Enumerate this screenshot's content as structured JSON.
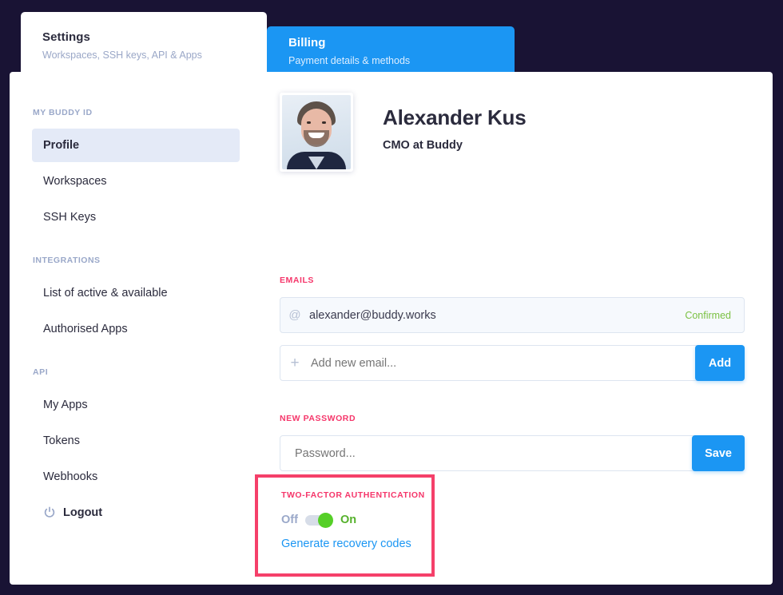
{
  "theme": {
    "background": "#191334",
    "panel": "#ffffff",
    "accent_blue": "#1b96f3",
    "accent_pink": "#f5366a",
    "accent_green": "#55cf27",
    "active_nav": "#e4eaf7",
    "muted_text": "#9aa8c9",
    "annotation_red": "#f5406a"
  },
  "tabs": [
    {
      "id": "settings",
      "title": "Settings",
      "subtitle": "Workspaces, SSH keys, API & Apps",
      "active": true
    },
    {
      "id": "billing",
      "title": "Billing",
      "subtitle": "Payment details & methods",
      "active": false
    }
  ],
  "sidebar": {
    "groups": [
      {
        "label": "MY BUDDY ID",
        "items": [
          {
            "label": "Profile",
            "active": true
          },
          {
            "label": "Workspaces",
            "active": false
          },
          {
            "label": "SSH Keys",
            "active": false
          }
        ]
      },
      {
        "label": "INTEGRATIONS",
        "items": [
          {
            "label": "List of active & available",
            "active": false
          },
          {
            "label": "Authorised Apps",
            "active": false
          }
        ]
      },
      {
        "label": "API",
        "items": [
          {
            "label": "My Apps",
            "active": false
          },
          {
            "label": "Tokens",
            "active": false
          },
          {
            "label": "Webhooks",
            "active": false
          }
        ]
      }
    ],
    "logout": {
      "label": "Logout",
      "icon": "power-icon"
    }
  },
  "profile": {
    "name": "Alexander Kus",
    "role": "CMO at Buddy",
    "avatar_alt": "Alexander Kus profile photo"
  },
  "emails": {
    "label": "EMAILS",
    "existing": {
      "icon": "at-icon",
      "address": "alexander@buddy.works",
      "status": "Confirmed",
      "status_color": "#7bc143"
    },
    "add": {
      "icon": "plus-icon",
      "placeholder": "Add new email...",
      "value": "",
      "button_label": "Add"
    }
  },
  "new_password": {
    "label": "NEW PASSWORD",
    "placeholder": "Password...",
    "value": "",
    "button_label": "Save"
  },
  "two_factor": {
    "label": "TWO-FACTOR AUTHENTICATION",
    "off_label": "Off",
    "on_label": "On",
    "enabled": true,
    "recovery_link_label": "Generate recovery codes"
  }
}
